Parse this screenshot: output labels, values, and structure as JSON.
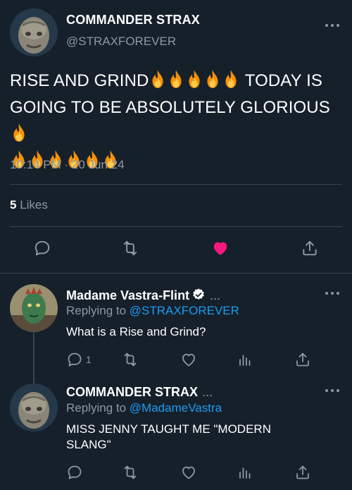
{
  "main_tweet": {
    "author_name": "COMMANDER STRAX",
    "author_handle": "@STRAXFOREVER",
    "text_line1": "RISE AND GRIND",
    "text_line1_after": "TODAY IS",
    "text_line2": "GOING TO BE ABSOLUTELY GLORIOUS",
    "timestamp": "10:14 PM · 20 Jun 24",
    "likes_count": "5",
    "likes_label": "Likes",
    "liked": true
  },
  "replies": [
    {
      "author_name": "Madame Vastra-Flint",
      "verified": true,
      "name_suffix": "...",
      "replying_prefix": "Replying to",
      "replying_handle": "@STRAXFOREVER",
      "text": "What is a Rise and Grind?",
      "reply_count": "1"
    },
    {
      "author_name": "COMMANDER STRAX",
      "name_suffix": "...",
      "replying_prefix": "Replying to",
      "replying_handle": "@MadameVastra",
      "text": "MISS JENNY TAUGHT ME \"MODERN SLANG\""
    }
  ],
  "icons": {
    "reply": "speech-bubble-icon",
    "retweet": "retweet-icon",
    "like": "heart-icon",
    "analytics": "bar-chart-icon",
    "share": "share-icon",
    "more": "more-icon",
    "emoji": "fire-emoji"
  },
  "colors": {
    "background": "#15202b",
    "text": "#ffffff",
    "muted": "#8b98a5",
    "link": "#1d9bf0",
    "like_active": "#f91880",
    "divider": "#38444d"
  }
}
